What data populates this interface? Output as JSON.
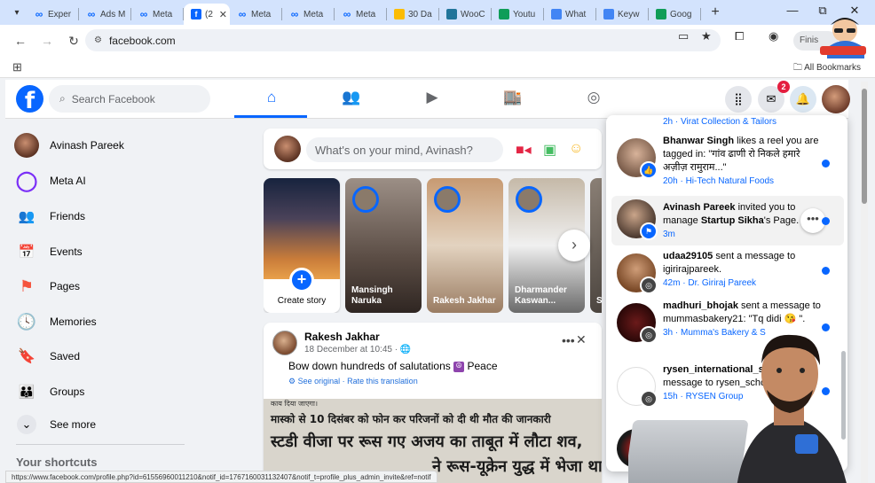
{
  "browser": {
    "tabs": [
      {
        "label": "Exper",
        "icon": "meta-icon",
        "color": "#0866ff"
      },
      {
        "label": "Ads M",
        "icon": "meta-icon",
        "color": "#0866ff"
      },
      {
        "label": "Meta",
        "icon": "meta-icon",
        "color": "#0866ff"
      },
      {
        "label": "(2",
        "icon": "facebook-icon",
        "color": "#0866ff",
        "active": true
      },
      {
        "label": "Meta",
        "icon": "meta-icon",
        "color": "#0866ff"
      },
      {
        "label": "Meta",
        "icon": "meta-icon",
        "color": "#0866ff"
      },
      {
        "label": "Meta",
        "icon": "meta-icon",
        "color": "#0866ff"
      },
      {
        "label": "30 Da",
        "icon": "drive-icon",
        "color": "#fbbc04"
      },
      {
        "label": "WooC",
        "icon": "wordpress-icon",
        "color": "#21759b"
      },
      {
        "label": "Youtu",
        "icon": "sheets-icon",
        "color": "#0f9d58"
      },
      {
        "label": "What",
        "icon": "google-icon",
        "color": "#4285f4"
      },
      {
        "label": "Keyw",
        "icon": "ads-icon",
        "color": "#4285f4"
      },
      {
        "label": "Goog",
        "icon": "sheets-icon",
        "color": "#0f9d58"
      }
    ],
    "url": "facebook.com",
    "finish_label": "Finis",
    "all_bookmarks": "All Bookmarks",
    "status_url": "https://www.facebook.com/profile.php?id=61556960011210&notif_id=1767160031132407&notif_t=profile_plus_admin_invite&ref=notif"
  },
  "fb": {
    "search_placeholder": "Search Facebook",
    "messenger_badge": "2",
    "accent": "#0866ff"
  },
  "sidebar": {
    "items": [
      {
        "label": "Avinash Pareek",
        "icon": "avatar"
      },
      {
        "label": "Meta AI",
        "icon": "meta-ai-icon"
      },
      {
        "label": "Friends",
        "icon": "friends-icon"
      },
      {
        "label": "Events",
        "icon": "events-icon"
      },
      {
        "label": "Pages",
        "icon": "pages-icon"
      },
      {
        "label": "Memories",
        "icon": "memories-icon"
      },
      {
        "label": "Saved",
        "icon": "saved-icon"
      },
      {
        "label": "Groups",
        "icon": "groups-icon"
      },
      {
        "label": "See more",
        "icon": "chevron-down-icon"
      }
    ],
    "shortcuts_heading": "Your shortcuts"
  },
  "composer": {
    "placeholder": "What's on your mind, Avinash?"
  },
  "stories": {
    "create_label": "Create story",
    "items": [
      {
        "name": "Mansingh Naruka"
      },
      {
        "name": "Rakesh Jakhar"
      },
      {
        "name": "Dharmander Kaswan..."
      },
      {
        "name": "S"
      }
    ]
  },
  "post": {
    "author": "Rakesh Jakhar",
    "date": "18 December at 10:45",
    "text": "Bow down hundreds of salutations",
    "text_suffix": "Peace",
    "see_original": "See original",
    "rate_translation": "Rate this translation",
    "separator": "·",
    "newspaper_lines": [
      "मास्को से 10 दिसंबर को फोन कर परिजनों को दी थी मौत की जानकारी",
      "स्टडी वीजा पर रूस गए अजय का ताबूत में लौटा शव,",
      "ने रूस-यूक्रेन युद्ध में भेजा था"
    ],
    "newspaper_top": "काय दिया जाएगा।"
  },
  "notifications": [
    {
      "actor": "",
      "text": "",
      "time": "2h",
      "source": "Virat Collection & Tailors",
      "dot": false,
      "badge": "none"
    },
    {
      "actor": "Bhanwar Singh",
      "text": "likes a reel you are tagged in: \"गांव ढाणी रो निकले हमारे अज़ीज़ रामुराम...\"",
      "time": "20h",
      "source": "Hi-Tech Natural Foods",
      "dot": true,
      "badge": "like-icon"
    },
    {
      "actor": "Avinash Pareek",
      "text": "invited you to manage",
      "page": "Startup Sikha",
      "text_end": "'s Page.",
      "time": "3m",
      "source": "",
      "dot": true,
      "badge": "page-icon"
    },
    {
      "actor": "udaa29105",
      "text": "sent a message to igirirajpareek.",
      "time": "42m",
      "source": "Dr. Giriraj Pareek",
      "dot": true,
      "badge": "instagram-icon"
    },
    {
      "actor": "madhuri_bhojak",
      "text": "sent a message to mummasbakery21: \"Tq didi 😘 \".",
      "time": "3h",
      "source": "Mumma's Bakery & S",
      "dot": true,
      "badge": "instagram-icon"
    },
    {
      "actor": "rysen_international_scho",
      "text": "sent a message to rysen_school_bikan",
      "time": "15h",
      "source": "RYSEN Group",
      "dot": true,
      "badge": "instagram-icon"
    }
  ]
}
